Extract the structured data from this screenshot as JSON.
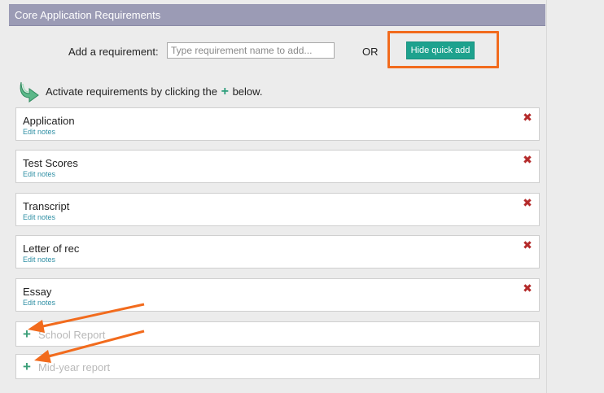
{
  "header": {
    "title": "Core Application Requirements"
  },
  "add_requirement": {
    "label": "Add a requirement:",
    "placeholder": "Type requirement name to add...",
    "or_label": "OR",
    "quick_add_button": "Hide quick add"
  },
  "activate": {
    "text_before": "Activate requirements by clicking the",
    "plus_glyph": "+",
    "text_after": "below."
  },
  "active_requirements": [
    {
      "name": "Application",
      "notes_link": "Edit notes"
    },
    {
      "name": "Test Scores",
      "notes_link": "Edit notes"
    },
    {
      "name": "Transcript",
      "notes_link": "Edit notes"
    },
    {
      "name": "Letter of rec",
      "notes_link": "Edit notes"
    },
    {
      "name": "Essay",
      "notes_link": "Edit notes"
    }
  ],
  "inactive_requirements": [
    {
      "name": "School Report"
    },
    {
      "name": "Mid-year report"
    }
  ],
  "colors": {
    "header_bg": "#9b9bb5",
    "button_bg": "#1ea28e",
    "annotation_orange": "#f26b1d",
    "remove_red": "#b42a2a",
    "link_teal": "#2f8fa4"
  }
}
